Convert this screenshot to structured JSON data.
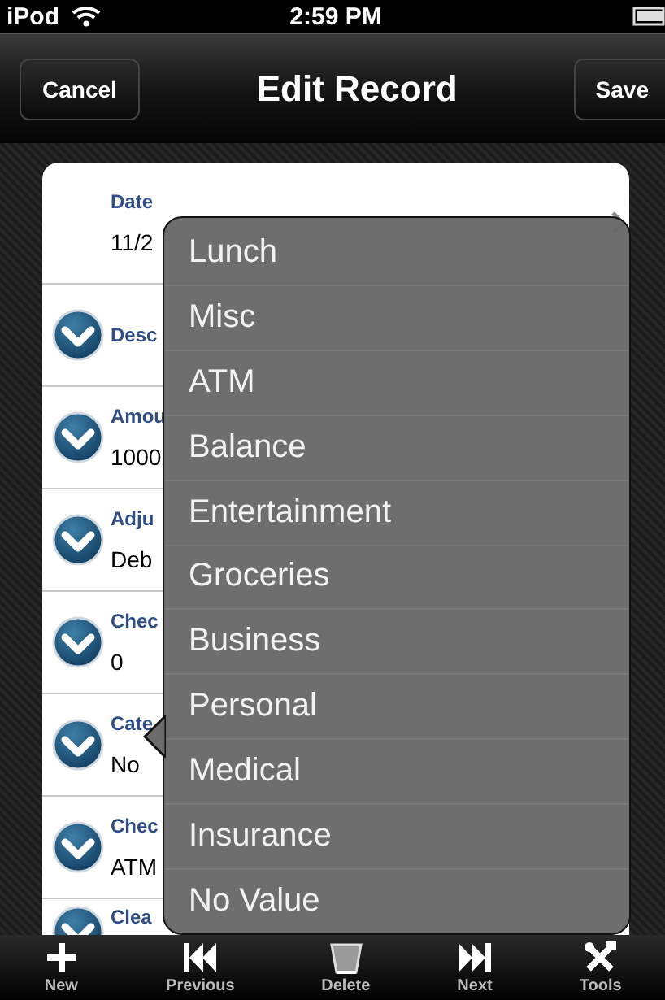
{
  "status_bar": {
    "carrier": "iPod",
    "time": "2:59 PM"
  },
  "nav_bar": {
    "left_button": "Cancel",
    "title": "Edit Record",
    "right_button": "Save"
  },
  "fields": [
    {
      "kind": "plain",
      "label": "Date",
      "value": "11/2"
    },
    {
      "kind": "menu",
      "label": "Desc"
    },
    {
      "kind": "menu",
      "label": "Amou",
      "value": "1000"
    },
    {
      "kind": "menu",
      "label": "Adju",
      "value": "Deb"
    },
    {
      "kind": "menu",
      "label": "Chec",
      "value": "0"
    },
    {
      "kind": "menu",
      "label": "Cate",
      "value": "No"
    },
    {
      "kind": "menu",
      "label": "Chec",
      "value": "ATM"
    },
    {
      "kind": "menu",
      "label": "Clea"
    }
  ],
  "popup_menu": {
    "items": [
      "Lunch",
      "Misc",
      "ATM",
      "Balance",
      "Entertainment",
      "Groceries",
      "Business",
      "Personal",
      "Medical",
      "Insurance",
      "No Value"
    ]
  },
  "toolbar": [
    {
      "kind": "new",
      "label": "New"
    },
    {
      "kind": "previous",
      "label": "Previous"
    },
    {
      "kind": "delete",
      "label": "Delete"
    },
    {
      "kind": "next",
      "label": "Next"
    },
    {
      "kind": "tools",
      "label": "Tools"
    }
  ]
}
